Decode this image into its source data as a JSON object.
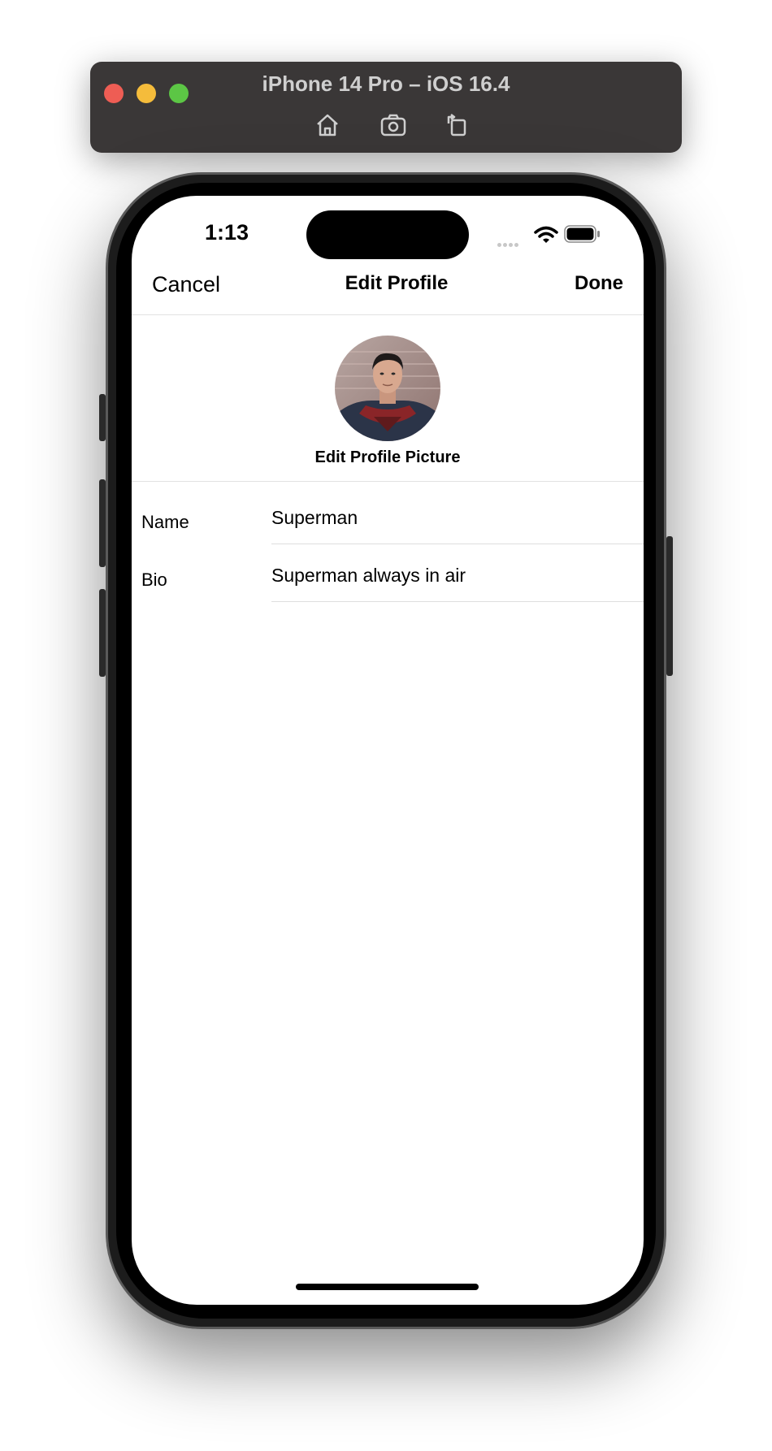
{
  "simulator": {
    "title": "iPhone 14 Pro – iOS 16.4",
    "tools": [
      "home-icon",
      "screenshot-icon",
      "rotate-icon"
    ]
  },
  "status_bar": {
    "time": "1:13"
  },
  "nav": {
    "cancel_label": "Cancel",
    "title": "Edit Profile",
    "done_label": "Done"
  },
  "profile": {
    "avatar_icon": "profile-photo",
    "edit_picture_label": "Edit Profile Picture"
  },
  "form": {
    "name_label": "Name",
    "name_value": "Superman",
    "bio_label": "Bio",
    "bio_value": "Superman always in air"
  }
}
